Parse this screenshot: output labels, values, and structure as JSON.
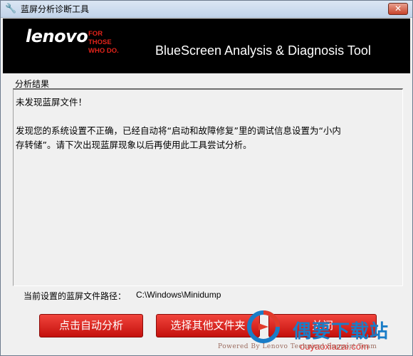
{
  "window": {
    "title": "蓝屏分析诊断工具",
    "close_glyph": "✕"
  },
  "banner": {
    "logo": "lenovo",
    "tagline": [
      "FOR",
      "THOSE",
      "WHO DO."
    ],
    "tool_title": "BlueScreen Analysis & Diagnosis Tool"
  },
  "result": {
    "group_label": "分析结果",
    "line1": "未发现蓝屏文件！",
    "line2": "发现您的系统设置不正确，已经自动将“启动和故障修复”里的调试信息设置为“小内",
    "line3": "存转储”。请下次出现蓝屏现象以后再使用此工具尝试分析。"
  },
  "path": {
    "label": "当前设置的蓝屏文件路径：",
    "value": "C:\\Windows\\Minidump"
  },
  "buttons": {
    "auto": "点击自动分析",
    "choose": "选择其他文件夹",
    "close": "关闭"
  },
  "watermark": {
    "brand": "偶要下载站",
    "url": "ouyaoxiazai.com",
    "powered": "Powered By Lenovo Technical Support Team"
  },
  "colors": {
    "accent_red": "#d01a14",
    "banner_bg": "#000000",
    "watermark_blue": "#1a7dc7"
  },
  "icons": {
    "title": "wrench-icon",
    "close": "close-icon"
  }
}
